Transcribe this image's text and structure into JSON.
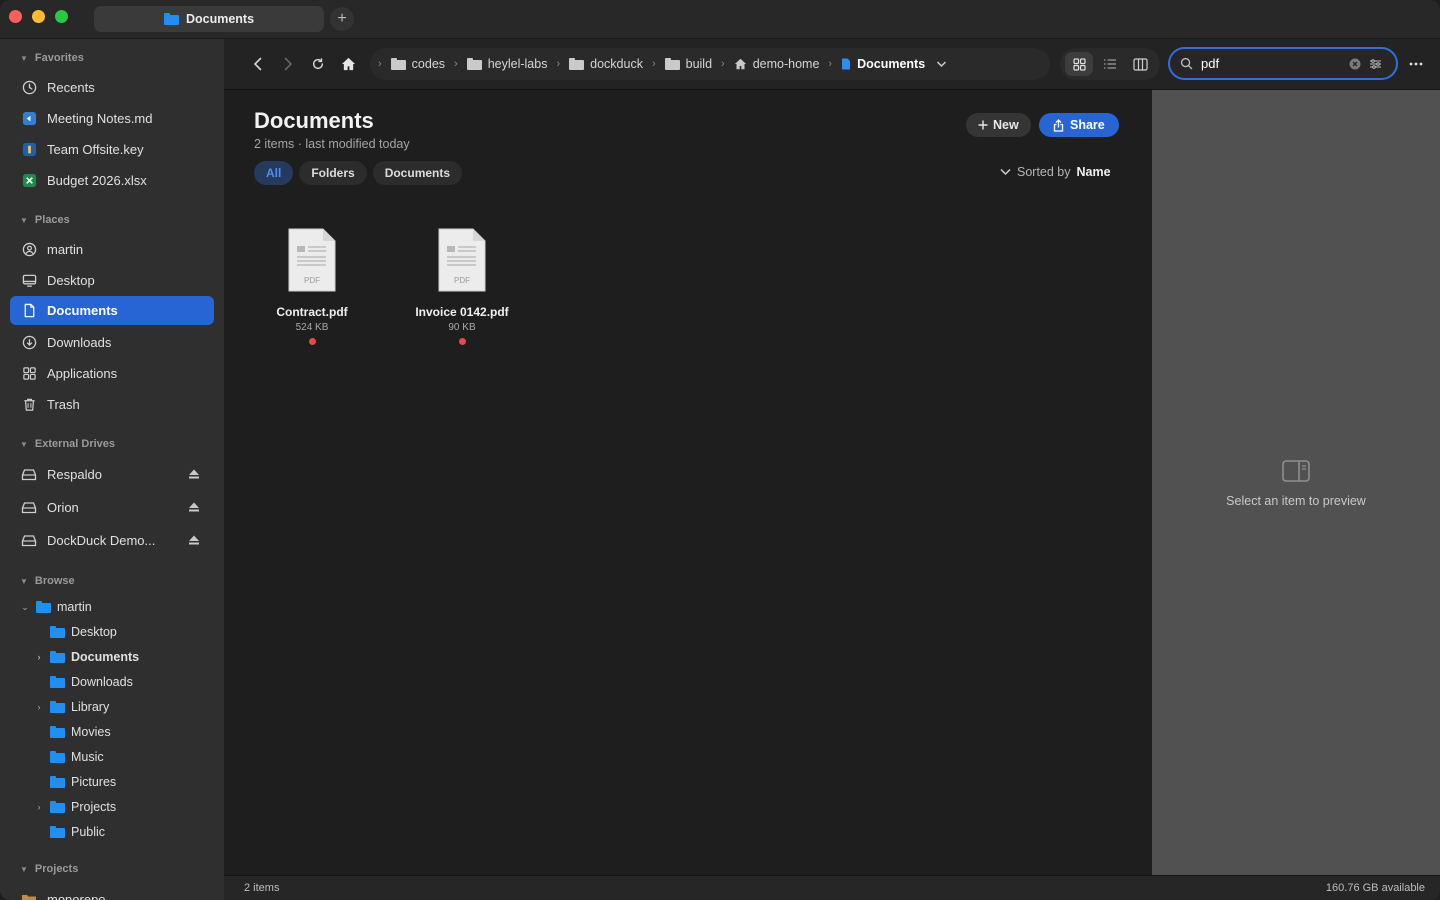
{
  "window": {
    "tab_title": "Documents",
    "tab_add": "+"
  },
  "sidebar": {
    "favorites": {
      "heading": "Favorites",
      "items": [
        {
          "label": "Recents",
          "icon": "clock-icon"
        },
        {
          "label": "Meeting Notes.md",
          "icon": "vscode-icon"
        },
        {
          "label": "Team Offsite.key",
          "icon": "keynote-icon"
        },
        {
          "label": "Budget 2026.xlsx",
          "icon": "excel-icon"
        }
      ]
    },
    "places": {
      "heading": "Places",
      "items": [
        {
          "label": "martin",
          "icon": "user-icon"
        },
        {
          "label": "Desktop",
          "icon": "desktop-icon"
        },
        {
          "label": "Documents",
          "icon": "document-icon",
          "active": true
        },
        {
          "label": "Downloads",
          "icon": "download-icon"
        },
        {
          "label": "Applications",
          "icon": "applications-icon"
        },
        {
          "label": "Trash",
          "icon": "trash-icon"
        }
      ]
    },
    "external": {
      "heading": "External Drives",
      "items": [
        {
          "label": "Respaldo",
          "icon": "drive-icon"
        },
        {
          "label": "Orion",
          "icon": "drive-icon"
        },
        {
          "label": "DockDuck Demo...",
          "icon": "drive-icon"
        }
      ]
    },
    "browse": {
      "heading": "Browse",
      "root": "martin",
      "children": [
        "Desktop",
        "Documents",
        "Downloads",
        "Library",
        "Movies",
        "Music",
        "Pictures",
        "Projects",
        "Public"
      ]
    },
    "projects": {
      "heading": "Projects",
      "items": [
        "monorepo"
      ]
    }
  },
  "toolbar": {
    "back": "‹",
    "forward": "›",
    "breadcrumbs": [
      "codes",
      "heylel-labs",
      "dockduck",
      "build",
      "demo-home",
      "Documents"
    ],
    "search": {
      "value": "pdf"
    }
  },
  "main": {
    "title": "Documents",
    "subtitle": "2 items · last modified today",
    "new_label": "New",
    "share_label": "Share",
    "filters": [
      "All",
      "Folders",
      "Documents"
    ],
    "sort_prefix": "Sorted by",
    "sort_field": "Name",
    "files": [
      {
        "name": "Contract.pdf",
        "size": "524 KB",
        "type_label": "PDF",
        "tag_color": "#e5484d"
      },
      {
        "name": "Invoice 0142.pdf",
        "size": "90 KB",
        "type_label": "PDF",
        "tag_color": "#e5484d"
      }
    ]
  },
  "preview": {
    "empty_text": "Select an item to preview"
  },
  "status": {
    "left": "2 items",
    "right": "160.76 GB available"
  },
  "colors": {
    "accent": "#2665d3",
    "folder": "#1d8ff5",
    "tag_red": "#e5484d"
  }
}
